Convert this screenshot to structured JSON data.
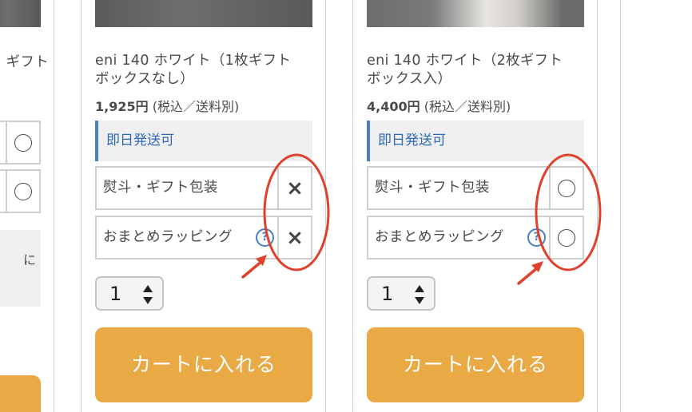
{
  "left_card": {
    "title_fragment": "ギフト",
    "side_text": "に"
  },
  "products": [
    {
      "title_line1": "eni 140 ホワイト（1枚ギフト",
      "title_line2": "ボックスなし）",
      "price": "1,925円",
      "price_note": "(税込／送料別)",
      "shipping": "即日発送可",
      "options": [
        {
          "label": "熨斗・ギフト包装",
          "mark": "×",
          "mark_icon": "cross-icon"
        },
        {
          "label": "おまとめラッピング",
          "help": "?",
          "mark": "×",
          "mark_icon": "cross-icon"
        }
      ],
      "quantity": "1",
      "cart_label": "カートに入れる"
    },
    {
      "title_line1": "eni 140 ホワイト（2枚ギフト",
      "title_line2": "ボックス入）",
      "price": "4,400円",
      "price_note": "(税込／送料別)",
      "shipping": "即日発送可",
      "options": [
        {
          "label": "熨斗・ギフト包装",
          "mark": "○",
          "mark_icon": "circle-icon"
        },
        {
          "label": "おまとめラッピング",
          "help": "?",
          "mark": "○",
          "mark_icon": "circle-icon"
        }
      ],
      "quantity": "1",
      "cart_label": "カートに入れる"
    }
  ],
  "colors": {
    "accent_blue": "#4a7fc1",
    "cart_orange": "#e9a945",
    "annotation_red": "#e0412c"
  }
}
